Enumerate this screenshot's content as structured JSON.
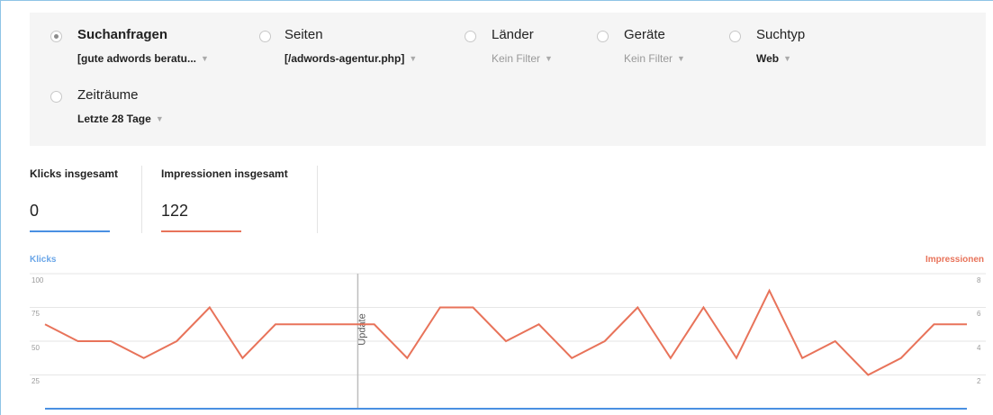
{
  "filters": [
    {
      "id": "suchanfragen",
      "label": "Suchanfragen",
      "value": "[gute adwords beratu...",
      "selected": true
    },
    {
      "id": "seiten",
      "label": "Seiten",
      "value": "[/adwords-agentur.php]",
      "selected": false
    },
    {
      "id": "laender",
      "label": "Länder",
      "value": "Kein Filter",
      "selected": false
    },
    {
      "id": "geraete",
      "label": "Geräte",
      "value": "Kein Filter",
      "selected": false
    },
    {
      "id": "suchtyp",
      "label": "Suchtyp",
      "value": "Web",
      "selected": false
    },
    {
      "id": "zeitraeume",
      "label": "Zeiträume",
      "value": "Letzte 28 Tage",
      "selected": false
    }
  ],
  "metrics": {
    "clicks": {
      "title": "Klicks insgesamt",
      "value": "0",
      "color": "#4a90e2"
    },
    "impressions": {
      "title": "Impressionen insgesamt",
      "value": "122",
      "color": "#e8735a"
    }
  },
  "chart_data": {
    "type": "line",
    "left_axis": {
      "title": "Klicks",
      "ticks": [
        "100",
        "75",
        "50",
        "25"
      ],
      "color": "#6aa6e8"
    },
    "right_axis": {
      "title": "Impressionen",
      "ticks": [
        "8",
        "6",
        "4",
        "2"
      ],
      "color": "#e8735a"
    },
    "annotation": {
      "label": "Update",
      "x_index": 9.5
    },
    "series": [
      {
        "name": "Impressionen",
        "color": "#e8735a",
        "axis": "right",
        "values": [
          5,
          4,
          4,
          3,
          4,
          6,
          3,
          5,
          5,
          5,
          5,
          3,
          6,
          6,
          4,
          5,
          3,
          4,
          6,
          3,
          6,
          3,
          7,
          3,
          4,
          2,
          3,
          5,
          5
        ]
      },
      {
        "name": "Klicks",
        "color": "#4a90e2",
        "axis": "left",
        "values": [
          0,
          0,
          0,
          0,
          0,
          0,
          0,
          0,
          0,
          0,
          0,
          0,
          0,
          0,
          0,
          0,
          0,
          0,
          0,
          0,
          0,
          0,
          0,
          0,
          0,
          0,
          0,
          0,
          0
        ]
      }
    ],
    "left_range": [
      0,
      100
    ],
    "right_range": [
      0,
      8
    ],
    "grid": true
  }
}
